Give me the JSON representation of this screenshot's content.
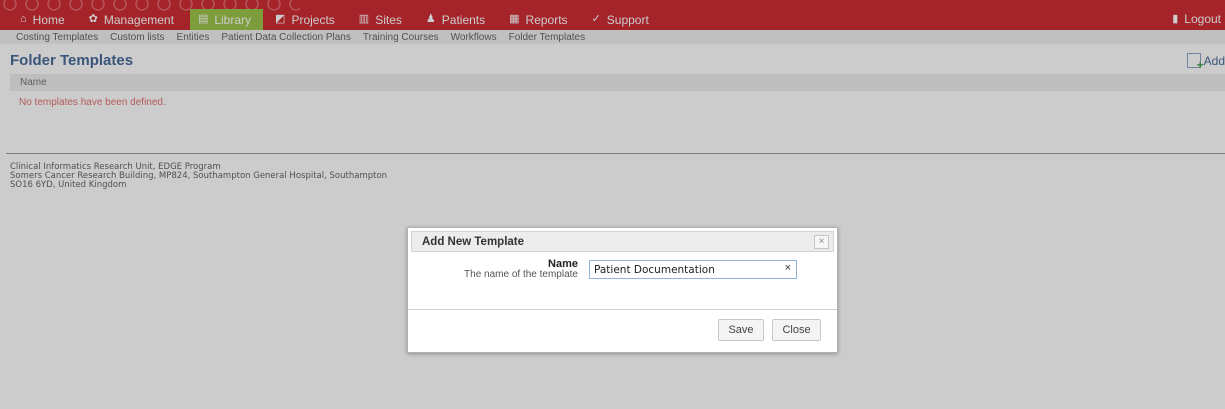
{
  "nav": {
    "items": [
      {
        "label": "Home",
        "icon": "home-icon",
        "glyph": "⌂"
      },
      {
        "label": "Management",
        "icon": "gear-icon",
        "glyph": "✿"
      },
      {
        "label": "Library",
        "icon": "library-icon",
        "glyph": "▤",
        "active": true
      },
      {
        "label": "Projects",
        "icon": "projects-icon",
        "glyph": "◩"
      },
      {
        "label": "Sites",
        "icon": "sites-icon",
        "glyph": "▥"
      },
      {
        "label": "Patients",
        "icon": "patient-icon",
        "glyph": "♟"
      },
      {
        "label": "Reports",
        "icon": "reports-icon",
        "glyph": "▦"
      },
      {
        "label": "Support",
        "icon": "support-icon",
        "glyph": "✓"
      }
    ],
    "logout": "Logout",
    "colors": {
      "bar": "#cf2d35",
      "active": "#9dc44a"
    }
  },
  "subnav": {
    "items": [
      "Costing Templates",
      "Custom lists",
      "Entities",
      "Patient Data Collection Plans",
      "Training Courses",
      "Workflows",
      "Folder Templates"
    ]
  },
  "page": {
    "title": "Folder Templates",
    "add_label": "Add",
    "column_name": "Name",
    "empty_message": "No templates have been defined."
  },
  "footer": {
    "line1": "Clinical Informatics Research Unit, EDGE Program",
    "line2": "Somers Cancer Research Building, MP824, Southampton General Hospital, Southampton",
    "line3": "SO16 6YD, United Kingdom"
  },
  "dialog": {
    "title": "Add New Template",
    "close_glyph": "×",
    "field_label": "Name",
    "field_description": "The name of the template",
    "field_value": "Patient Documentation",
    "clear_glyph": "×",
    "save_label": "Save",
    "close_label": "Close"
  }
}
